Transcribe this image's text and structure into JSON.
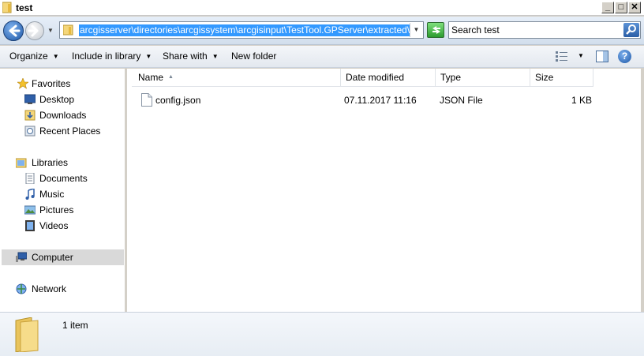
{
  "window": {
    "title": "test",
    "buttons": {
      "minimize": "_",
      "maximize": "□",
      "close": "✕"
    }
  },
  "address": {
    "path": "arcgisserver\\directories\\arcgissystem\\arcgisinput\\TestTool.GPServer\\extracted\\cd\\test"
  },
  "search": {
    "placeholder": "Search test"
  },
  "toolbar": {
    "organize": "Organize",
    "include_in_library": "Include in library",
    "share_with": "Share with",
    "new_folder": "New folder",
    "help": "?"
  },
  "navigation": {
    "favorites": {
      "label": "Favorites",
      "icon": "star-icon",
      "items": [
        {
          "label": "Desktop",
          "icon": "desktop-icon"
        },
        {
          "label": "Downloads",
          "icon": "downloads-icon"
        },
        {
          "label": "Recent Places",
          "icon": "recent-places-icon"
        }
      ]
    },
    "libraries": {
      "label": "Libraries",
      "icon": "libraries-icon",
      "items": [
        {
          "label": "Documents",
          "icon": "documents-icon"
        },
        {
          "label": "Music",
          "icon": "music-icon"
        },
        {
          "label": "Pictures",
          "icon": "pictures-icon"
        },
        {
          "label": "Videos",
          "icon": "videos-icon"
        }
      ]
    },
    "computer": {
      "label": "Computer",
      "icon": "computer-icon",
      "selected": true
    },
    "network": {
      "label": "Network",
      "icon": "network-icon"
    }
  },
  "columns": {
    "name": "Name",
    "date_modified": "Date modified",
    "type": "Type",
    "size": "Size"
  },
  "files": [
    {
      "name": "config.json",
      "date_modified": "07.11.2017 11:16",
      "type": "JSON File",
      "size": "1 KB",
      "icon": "file-icon"
    }
  ],
  "status": {
    "item_count": "1 item"
  },
  "colors": {
    "selection": "#3399ff",
    "nav_selected": "#d9d9d9",
    "folder": "#f4d67a"
  }
}
